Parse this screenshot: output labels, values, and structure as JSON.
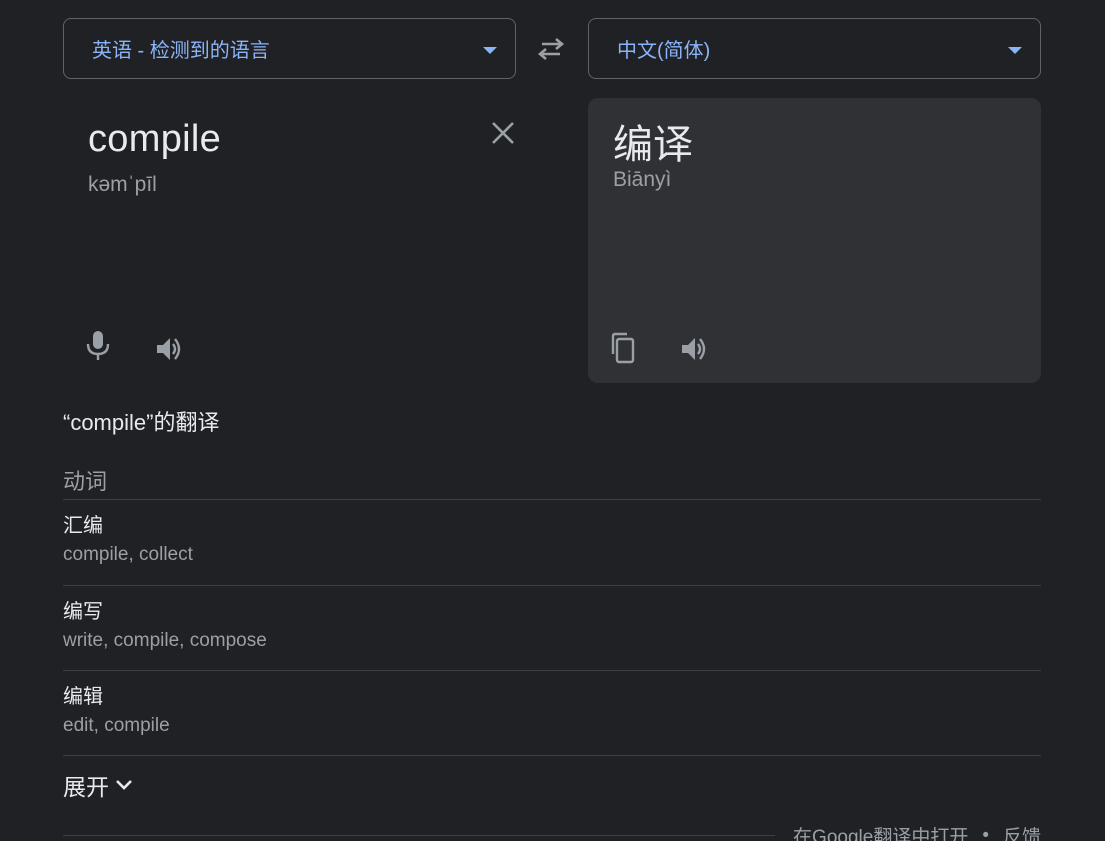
{
  "source_language": {
    "label": "英语 - 检测到的语言"
  },
  "target_language": {
    "label": "中文(简体)"
  },
  "source": {
    "text": "compile",
    "phonetic": "kəmˈpīl"
  },
  "target": {
    "text": "编译",
    "phonetic": "Biānyì"
  },
  "definitions": {
    "title": "“compile”的翻译",
    "part_of_speech": "动词",
    "entries": [
      {
        "term": "汇编",
        "synonyms": "compile, collect"
      },
      {
        "term": "编写",
        "synonyms": "write, compile, compose"
      },
      {
        "term": "编辑",
        "synonyms": "edit, compile"
      }
    ],
    "expand_label": "展开"
  },
  "footer": {
    "open_link": "在Google翻译中打开",
    "separator": "•",
    "feedback_link": "反馈"
  },
  "icons": {
    "dropdown": "caret-down-icon",
    "swap": "swap-icon",
    "clear": "close-icon",
    "mic": "mic-icon",
    "speaker": "speaker-icon",
    "copy": "copy-icon",
    "expand": "chevron-down-icon"
  },
  "colors": {
    "background": "#202124",
    "panel": "#303134",
    "accent": "#8ab4f8",
    "text": "#e8eaed",
    "muted": "#9aa0a6"
  }
}
